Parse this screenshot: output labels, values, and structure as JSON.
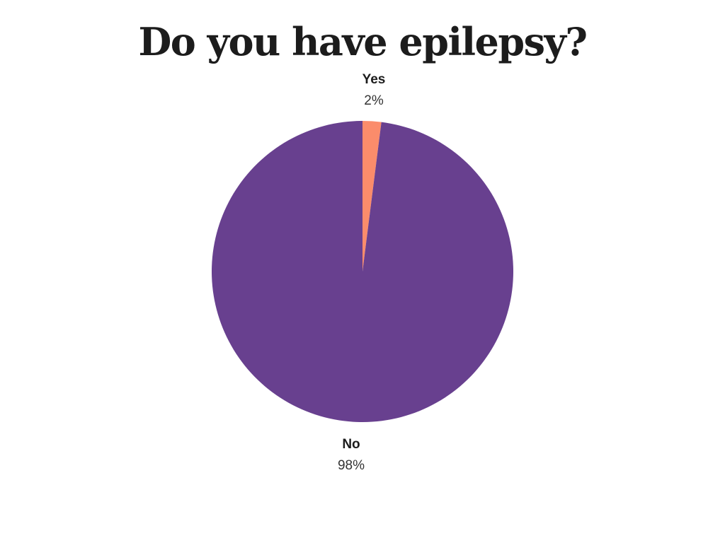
{
  "chart_data": {
    "type": "pie",
    "title": "Do you have epilepsy?",
    "slices": [
      {
        "label": "Yes",
        "value": 2,
        "display": "2%",
        "color": "#fb8c6b"
      },
      {
        "label": "No",
        "value": 98,
        "display": "98%",
        "color": "#68408f"
      }
    ],
    "start_angle": "12 o'clock",
    "direction": "clockwise",
    "legend": "none"
  }
}
